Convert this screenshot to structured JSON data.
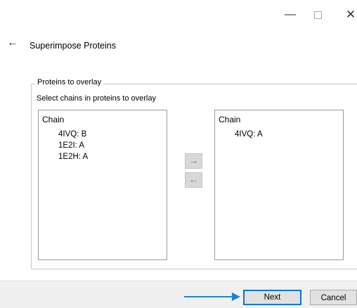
{
  "window": {
    "minimize_glyph": "—",
    "close_glyph": "✕"
  },
  "header": {
    "back_glyph": "←",
    "title": "Superimpose Proteins"
  },
  "group": {
    "legend": "Proteins to overlay",
    "instruction": "Select chains in proteins to overlay"
  },
  "left_list": {
    "header": "Chain",
    "items": [
      "4IVQ: B",
      "1E2I: A",
      "1E2H: A"
    ]
  },
  "right_list": {
    "header": "Chain",
    "items": [
      "4IVQ: A"
    ]
  },
  "transfer": {
    "add_glyph": "→",
    "remove_glyph": "←"
  },
  "footer": {
    "next_label": "Next",
    "cancel_label": "Cancel"
  },
  "colors": {
    "accent": "#0078d7",
    "pointer": "#1a86d0",
    "footer_bg": "#f0f0f0"
  }
}
